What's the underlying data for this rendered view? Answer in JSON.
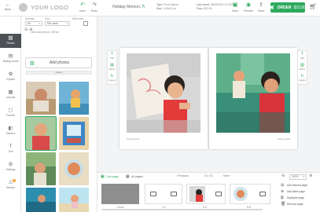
{
  "topbar": {
    "back_label": "Back",
    "logo_text": "YOUR LOGO",
    "undo_label": "Undo",
    "redo_label": "Redo",
    "project_name": "Holiday Memori...",
    "type_label": "Type:",
    "type_value": "Photo Album",
    "size_label": "Size:",
    "size_value": "L/20x20 cm",
    "last_saved_label": "Last saved:",
    "last_saved_value": "28/09/2023 12:33 PM",
    "price_label": "Price:",
    "price_value": "$23.99",
    "save_label": "Save",
    "preview_label": "Preview",
    "share_label": "Share",
    "order_label": "ORDER",
    "order_price": "$23.99"
  },
  "nav": {
    "items": [
      {
        "label": "Photos",
        "icon": "image-icon"
      },
      {
        "label": "Backgrounds",
        "icon": "backgrounds-icon"
      },
      {
        "label": "Cliparts",
        "icon": "cliparts-icon"
      },
      {
        "label": "Layouts",
        "icon": "layouts-icon"
      },
      {
        "label": "Frames",
        "icon": "frames-icon"
      },
      {
        "label": "Stickers",
        "icon": "stickers-icon"
      },
      {
        "label": "Text",
        "icon": "text-icon"
      },
      {
        "label": "Settings",
        "icon": "settings-icon"
      },
      {
        "label": "Notices",
        "icon": "bell-icon"
      }
    ]
  },
  "panel": {
    "source_label": "Sources",
    "sort_label": "Sort",
    "hide_used_label": "Hide used",
    "source_value": "All",
    "sort_value": "File name",
    "count_text": "148 used photos / 335 all",
    "add_photos_label": "Add photos",
    "folder_label": "august"
  },
  "canvas": {
    "tools": [
      {
        "label": "Text",
        "icon": "text-add-icon"
      },
      {
        "label": "Photo",
        "icon": "photo-add-icon"
      },
      {
        "label": "Layout",
        "icon": "layout-icon"
      }
    ],
    "left_caption": "Holiday 2023",
    "right_caption": "Holiday 2023"
  },
  "bottom": {
    "tab_one": "One page",
    "tab_all": "All pages",
    "prev_label": "Previous",
    "page_counter": "15 / 21",
    "next_label": "Next",
    "zoom_value": "100%",
    "pages": [
      {
        "label": "Cover"
      },
      {
        "label": "1-2"
      },
      {
        "label": "3-4"
      },
      {
        "label": "5-6"
      }
    ],
    "actions": [
      {
        "label": "Add themed page",
        "icon": "add-themed-icon"
      },
      {
        "label": "Add blank page",
        "icon": "add-blank-icon"
      },
      {
        "label": "Duplicate page",
        "icon": "duplicate-icon"
      },
      {
        "label": "Remove page",
        "icon": "trash-icon"
      }
    ]
  },
  "colors": {
    "accent": "#2eaa5e",
    "nav_active": "#4d5055",
    "badge": "#f0a23a"
  }
}
